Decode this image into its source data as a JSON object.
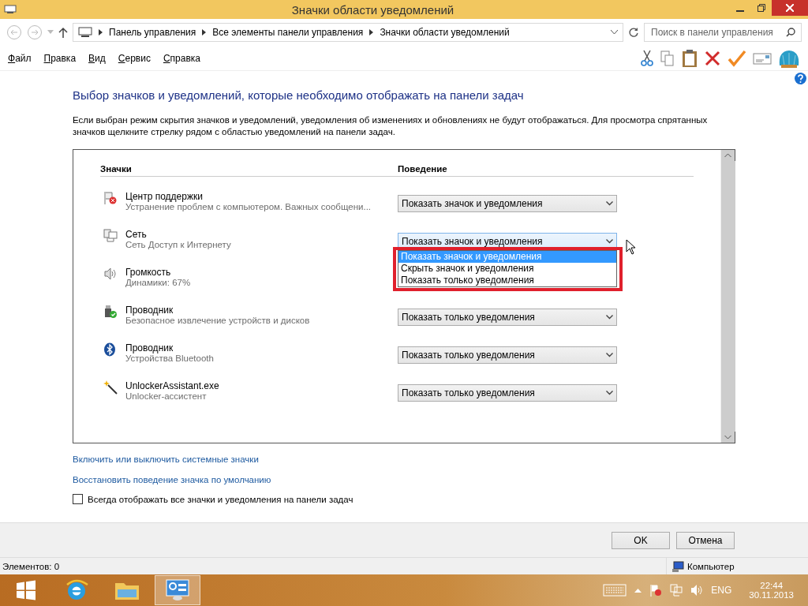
{
  "window": {
    "title": "Значки области уведомлений"
  },
  "address": {
    "crumbs": [
      "Панель управления",
      "Все элементы панели управления",
      "Значки области уведомлений"
    ],
    "search_placeholder": "Поиск в панели управления"
  },
  "menu": [
    "Файл",
    "Правка",
    "Вид",
    "Сервис",
    "Справка"
  ],
  "heading": "Выбор значков и уведомлений, которые необходимо отображать на панели задач",
  "description": "Если выбран режим скрытия значков и уведомлений, уведомления об изменениях и обновлениях не будут отображаться. Для просмотра спрятанных значков щелкните стрелку рядом с областью уведомлений на панели задач.",
  "table": {
    "columns": [
      "Значки",
      "Поведение"
    ],
    "rows": [
      {
        "name": "Центр поддержки",
        "detail": "Устранение проблем с компьютером. Важных сообщени...",
        "behavior": "Показать значок и уведомления"
      },
      {
        "name": "Сеть",
        "detail": "Сеть Доступ к Интернету",
        "behavior": "Показать значок и уведомления",
        "open": true,
        "options": [
          {
            "label": "Показать значок и уведомления",
            "selected": true
          },
          {
            "label": "Скрыть значок и уведомления",
            "selected": false
          },
          {
            "label": "Показать только уведомления",
            "selected": false
          }
        ]
      },
      {
        "name": "Громкость",
        "detail": "Динамики: 67%"
      },
      {
        "name": "Проводник",
        "detail": "Безопасное извлечение устройств и дисков",
        "behavior": "Показать только уведомления"
      },
      {
        "name": "Проводник",
        "detail": "Устройства Bluetooth",
        "behavior": "Показать только уведомления"
      },
      {
        "name": "UnlockerAssistant.exe",
        "detail": "Unlocker-ассистент",
        "behavior": "Показать только уведомления"
      }
    ]
  },
  "links": [
    "Включить или выключить системные значки",
    "Восстановить поведение значка по умолчанию"
  ],
  "always_show": {
    "label": "Всегда отображать все значки и уведомления на панели задач",
    "checked": false
  },
  "buttons": [
    "OK",
    "Отмена"
  ],
  "status_bar": {
    "count": "Элементов: 0",
    "location": "Компьютер"
  },
  "taskbar": {
    "language": "ENG",
    "time": "22:44",
    "date": "30.11.2013"
  }
}
